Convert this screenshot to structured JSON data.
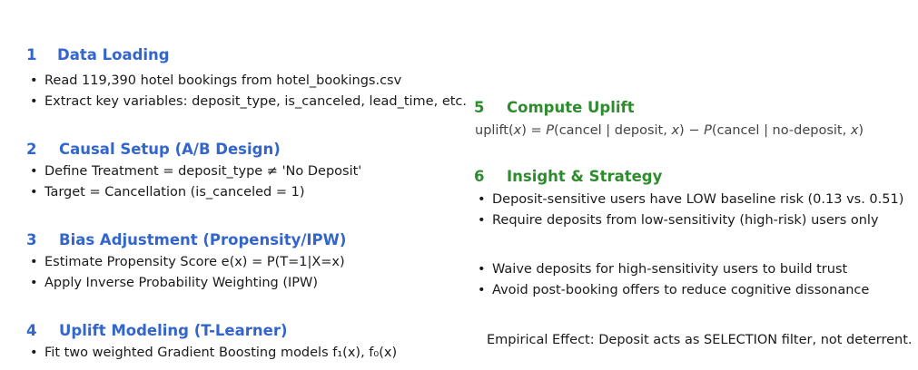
{
  "sections": [
    {
      "number": "1",
      "title": "Data Loading",
      "color": "#3366cc",
      "bullets": [
        "Read 119,390 hotel bookings from hotel_bookings.csv",
        "Extract key variables: deposit_type, is_canceled, lead_time, etc."
      ]
    },
    {
      "number": "2",
      "title": "Causal Setup (A/B Design)",
      "color": "#3366cc",
      "bullets": [
        "Define Treatment = deposit_type ≠ 'No Deposit'",
        "Target = Cancellation (is_canceled = 1)"
      ]
    },
    {
      "number": "3",
      "title": "Bias Adjustment (Propensity/IPW)",
      "color": "#3366cc",
      "bullets": [
        "Estimate Propensity Score e(x) = P(T=1|X=x)",
        "Apply Inverse Probability Weighting (IPW)"
      ]
    },
    {
      "number": "4",
      "title": "Uplift Modeling (T-Learner)",
      "color": "#3366cc",
      "bullets": [
        "Fit two weighted Gradient Boosting models f₁(x), f₀(x)"
      ]
    },
    {
      "number": "5",
      "title": "Compute Uplift",
      "color": "#2e8b2e",
      "formula": {
        "lhs": "uplift(",
        "x1": "x",
        "eq": ") = ",
        "p1": "P",
        "t1": "(cancel | deposit, ",
        "x2": "x",
        "t2": ") − ",
        "p2": "P",
        "t3": "(cancel | no-deposit, ",
        "x3": "x",
        "t4": ")"
      }
    },
    {
      "number": "6",
      "title": "Insight & Strategy",
      "color": "#2e8b2e",
      "bullets": [
        "Deposit-sensitive users have LOW baseline risk (0.13 vs. 0.51)",
        "Require deposits from low-sensitivity (high-risk) users only",
        "Waive deposits for high-sensitivity users to build trust",
        "Avoid post-booking offers to reduce cognitive dissonance"
      ]
    }
  ],
  "bullet_glyph": "•",
  "empirical_note": "Empirical Effect: Deposit acts as SELECTION filter, not deterrent."
}
